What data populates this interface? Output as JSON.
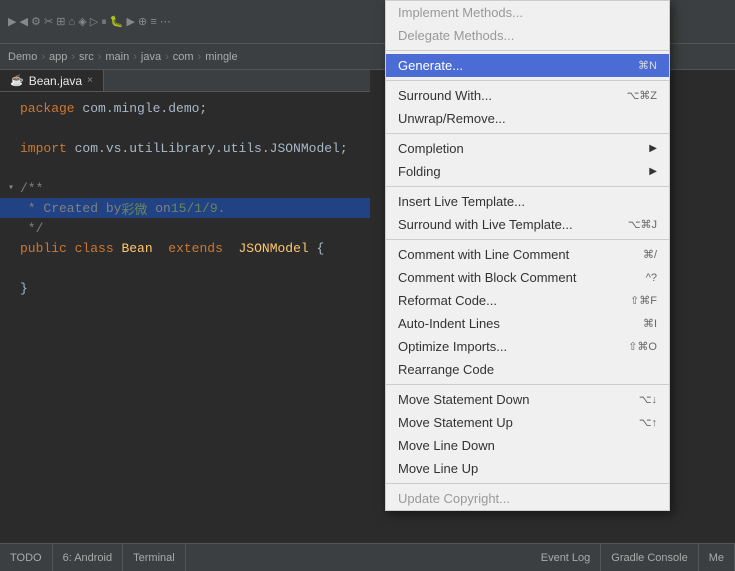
{
  "toolbar": {
    "icons": "toolbar-icons"
  },
  "nav": {
    "items": [
      "Demo",
      "app",
      "src",
      "main",
      "java",
      "com",
      "mingle"
    ]
  },
  "tab": {
    "filename": "Bean.java",
    "close": "×"
  },
  "code": {
    "lines": [
      {
        "num": "",
        "fold": "",
        "content": "package com.mingle.demo;",
        "type": "package",
        "highlight": false
      },
      {
        "num": "",
        "fold": "",
        "content": "",
        "type": "blank",
        "highlight": false
      },
      {
        "num": "",
        "fold": "",
        "content": "import com.vs.utilLibrary.utils.JSONModel;",
        "type": "import",
        "highlight": false
      },
      {
        "num": "",
        "fold": "",
        "content": "",
        "type": "blank",
        "highlight": false
      },
      {
        "num": "",
        "fold": "▾",
        "content": "/**",
        "type": "comment-open",
        "highlight": false
      },
      {
        "num": "",
        "fold": "",
        "content": " * Created by 彩微 on 15/1/9.",
        "type": "comment",
        "highlight": true
      },
      {
        "num": "",
        "fold": "",
        "content": " */",
        "type": "comment-close",
        "highlight": false
      },
      {
        "num": "",
        "fold": "",
        "content": "public class Bean  extends  JSONModel {",
        "type": "class",
        "highlight": false
      },
      {
        "num": "",
        "fold": "",
        "content": "",
        "type": "blank",
        "highlight": false
      },
      {
        "num": "",
        "fold": "",
        "content": "}",
        "type": "brace",
        "highlight": false
      }
    ]
  },
  "menu": {
    "items": [
      {
        "id": "implement-methods",
        "label": "Implement Methods...",
        "shortcut": "",
        "arrow": false,
        "disabled": true,
        "separator_after": false
      },
      {
        "id": "delegate-methods",
        "label": "Delegate Methods...",
        "shortcut": "",
        "arrow": false,
        "disabled": true,
        "separator_after": false
      },
      {
        "id": "generate",
        "label": "Generate...",
        "shortcut": "⌘N",
        "arrow": false,
        "disabled": false,
        "separator_after": true,
        "hover": true
      },
      {
        "id": "surround-with",
        "label": "Surround With...",
        "shortcut": "⌥⌘Z",
        "arrow": false,
        "disabled": false,
        "separator_after": false
      },
      {
        "id": "unwrap-remove",
        "label": "Unwrap/Remove...",
        "shortcut": "",
        "arrow": false,
        "disabled": false,
        "separator_after": true
      },
      {
        "id": "completion",
        "label": "Completion",
        "shortcut": "",
        "arrow": true,
        "disabled": false,
        "separator_after": false
      },
      {
        "id": "folding",
        "label": "Folding",
        "shortcut": "",
        "arrow": true,
        "disabled": false,
        "separator_after": true
      },
      {
        "id": "insert-live-template",
        "label": "Insert Live Template...",
        "shortcut": "",
        "arrow": false,
        "disabled": false,
        "separator_after": false
      },
      {
        "id": "surround-live-template",
        "label": "Surround with Live Template...",
        "shortcut": "⌥⌘J",
        "arrow": false,
        "disabled": false,
        "separator_after": true
      },
      {
        "id": "comment-line",
        "label": "Comment with Line Comment",
        "shortcut": "⌘/",
        "arrow": false,
        "disabled": false,
        "separator_after": false
      },
      {
        "id": "comment-block",
        "label": "Comment with Block Comment",
        "shortcut": "^?",
        "arrow": false,
        "disabled": false,
        "separator_after": false
      },
      {
        "id": "reformat-code",
        "label": "Reformat Code...",
        "shortcut": "⇧⌘F",
        "arrow": false,
        "disabled": false,
        "separator_after": false
      },
      {
        "id": "auto-indent",
        "label": "Auto-Indent Lines",
        "shortcut": "⌘I",
        "arrow": false,
        "disabled": false,
        "separator_after": false
      },
      {
        "id": "optimize-imports",
        "label": "Optimize Imports...",
        "shortcut": "⇧⌘O",
        "arrow": false,
        "disabled": false,
        "separator_after": false
      },
      {
        "id": "rearrange-code",
        "label": "Rearrange Code",
        "shortcut": "",
        "arrow": false,
        "disabled": false,
        "separator_after": true
      },
      {
        "id": "move-statement-down",
        "label": "Move Statement Down",
        "shortcut": "⌥↓",
        "arrow": false,
        "disabled": false,
        "separator_after": false
      },
      {
        "id": "move-statement-up",
        "label": "Move Statement Up",
        "shortcut": "⌥↑",
        "arrow": false,
        "disabled": false,
        "separator_after": false
      },
      {
        "id": "move-line-down",
        "label": "Move Line Down",
        "shortcut": "",
        "arrow": false,
        "disabled": false,
        "separator_after": false
      },
      {
        "id": "move-line-up",
        "label": "Move Line Up",
        "shortcut": "",
        "arrow": false,
        "disabled": false,
        "separator_after": true
      },
      {
        "id": "update-copyright",
        "label": "Update Copyright...",
        "shortcut": "",
        "arrow": false,
        "disabled": true,
        "separator_after": false
      }
    ]
  },
  "statusbar": {
    "items": [
      "TODO",
      "6: Android",
      "Terminal",
      "",
      "Event Log",
      "Gradle Console",
      "Me"
    ]
  }
}
